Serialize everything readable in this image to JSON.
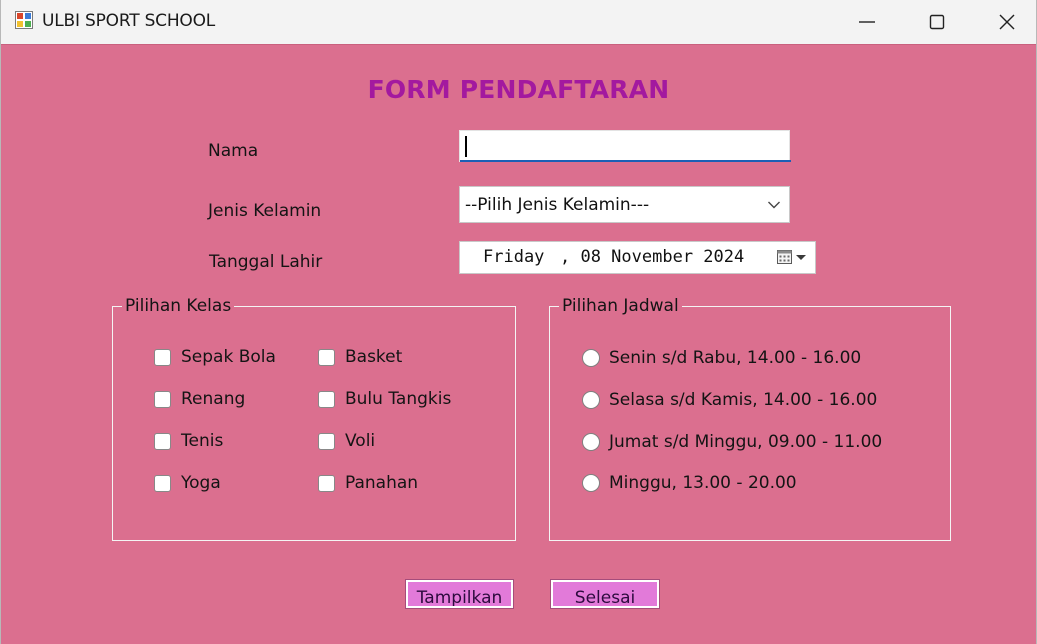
{
  "window": {
    "title": "ULBI SPORT SCHOOL",
    "controls": {
      "minimize": "minimize-icon",
      "maximize": "maximize-icon",
      "close": "close-icon"
    }
  },
  "form": {
    "title": "FORM PENDAFTARAN",
    "nama": {
      "label": "Nama",
      "value": ""
    },
    "jenis_kelamin": {
      "label": "Jenis Kelamin",
      "selected": "--Pilih Jenis Kelamin---"
    },
    "tanggal_lahir": {
      "label": "Tanggal Lahir",
      "day": "Friday",
      "date_rest": ", 08 November 2024"
    }
  },
  "pilihan_kelas": {
    "legend": "Pilihan Kelas",
    "items": [
      {
        "label": "Sepak Bola",
        "checked": false
      },
      {
        "label": "Basket",
        "checked": false
      },
      {
        "label": "Renang",
        "checked": false
      },
      {
        "label": "Bulu Tangkis",
        "checked": false
      },
      {
        "label": "Tenis",
        "checked": false
      },
      {
        "label": "Voli",
        "checked": false
      },
      {
        "label": "Yoga",
        "checked": false
      },
      {
        "label": "Panahan",
        "checked": false
      }
    ]
  },
  "pilihan_jadwal": {
    "legend": "Pilihan Jadwal",
    "items": [
      {
        "label": "Senin s/d Rabu, 14.00 - 16.00",
        "selected": false
      },
      {
        "label": "Selasa s/d Kamis, 14.00 - 16.00",
        "selected": false
      },
      {
        "label": "Jumat s/d Minggu, 09.00 - 11.00",
        "selected": false
      },
      {
        "label": "Minggu, 13.00 - 20.00",
        "selected": false
      }
    ]
  },
  "buttons": {
    "tampilkan": "Tampilkan",
    "selesai": "Selesai"
  },
  "colors": {
    "form_background": "#db6f8f",
    "title_color": "#a3199f",
    "button_color": "#e27ad9"
  }
}
